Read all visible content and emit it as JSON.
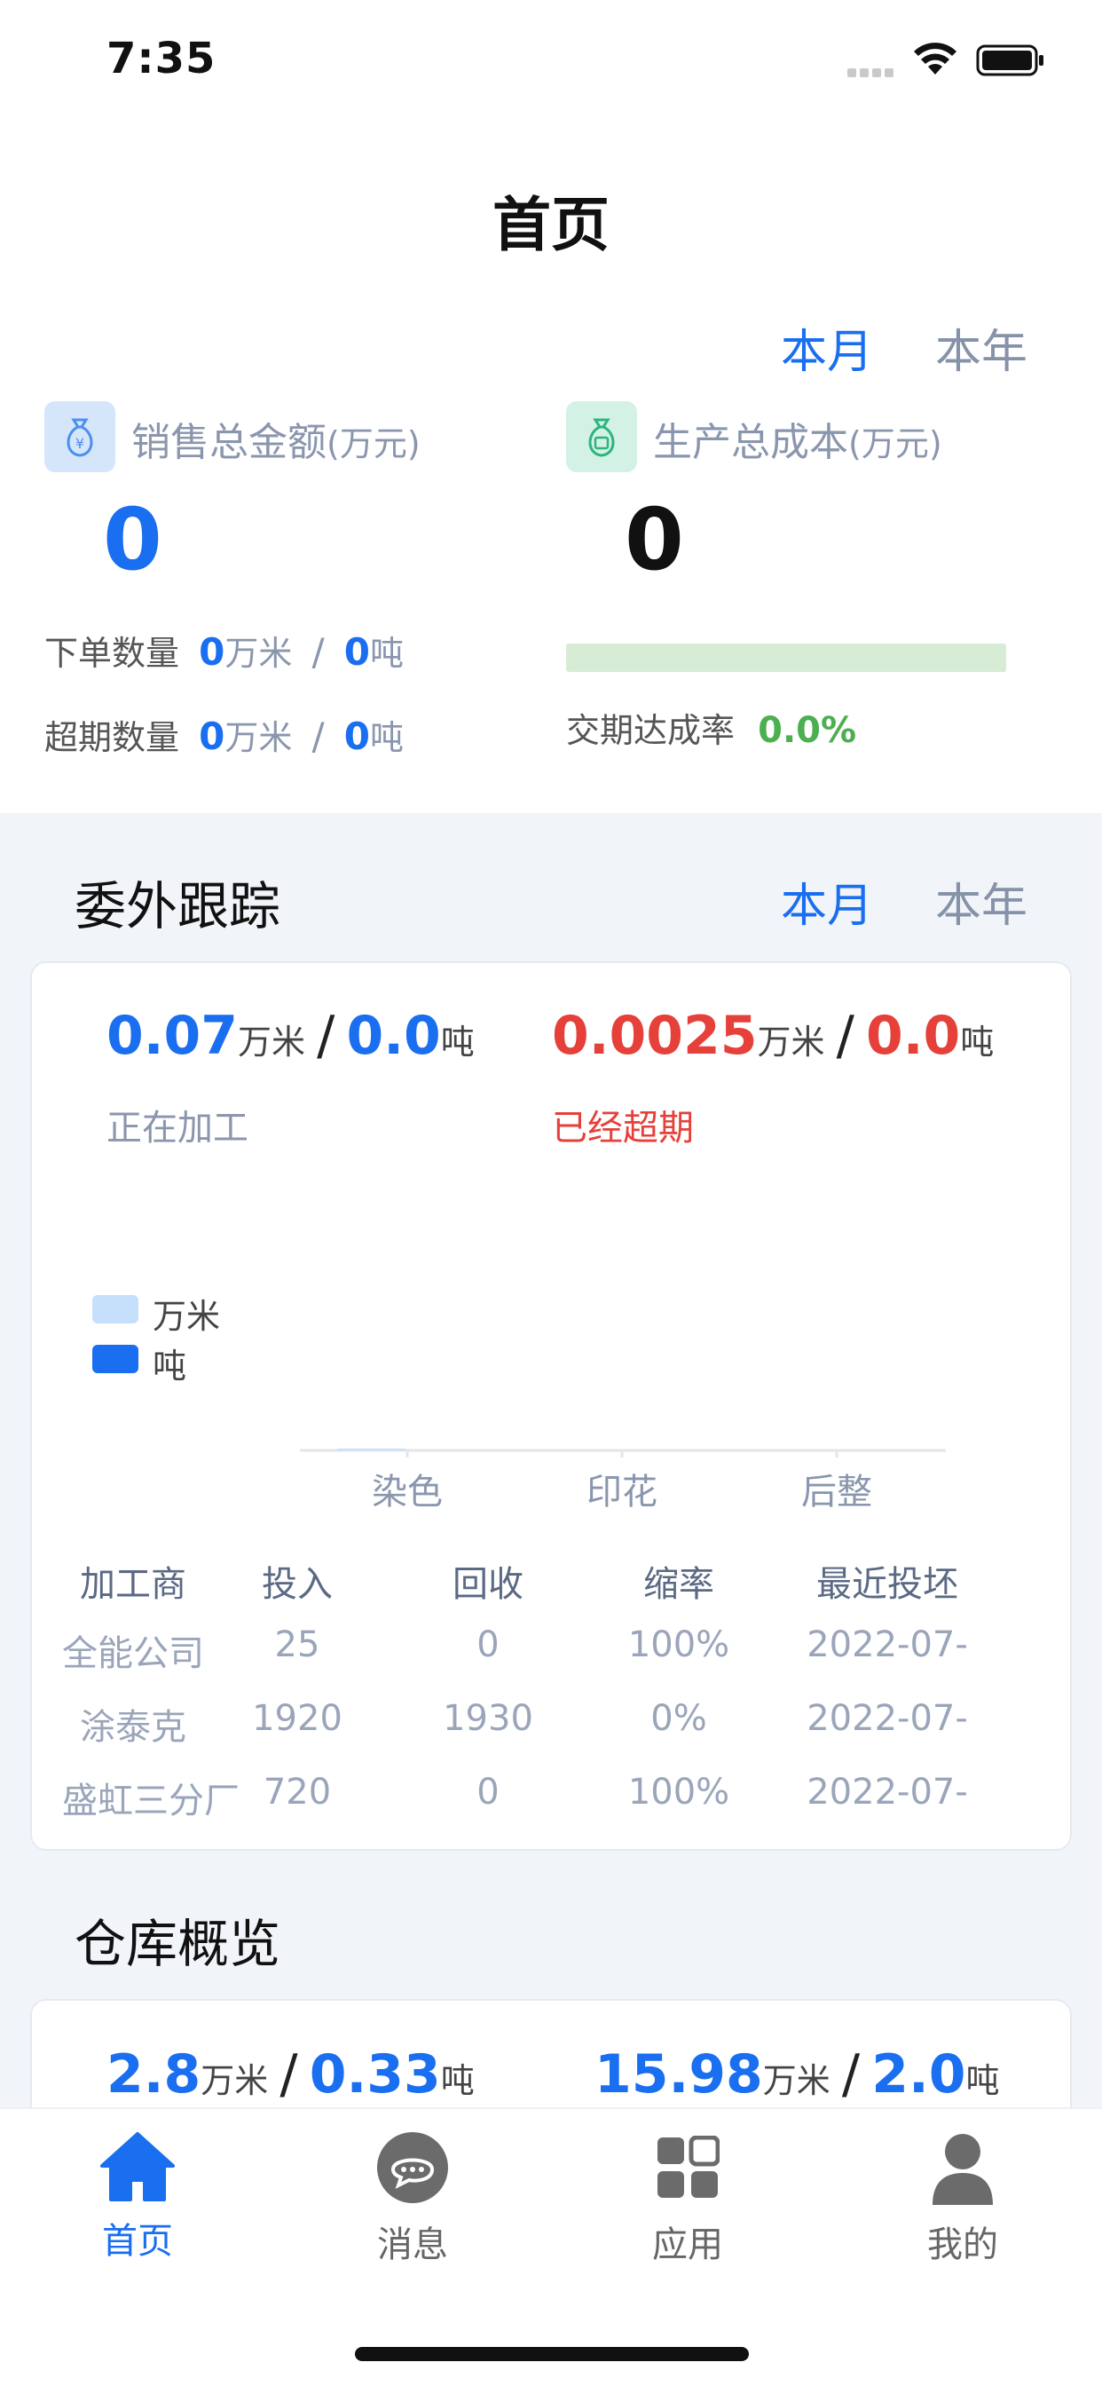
{
  "status": {
    "time": "7:35"
  },
  "header": {
    "title": "首页"
  },
  "top_tabs": {
    "month": "本月",
    "year": "本年"
  },
  "sales": {
    "label": "销售总金额",
    "unit": "(万元)",
    "value": "0",
    "order_label": "下单数量",
    "order_m": "0",
    "order_t": "0",
    "overdue_label": "超期数量",
    "overdue_m": "0",
    "overdue_t": "0",
    "unit_m": "万米",
    "unit_t": "吨",
    "slash": "/"
  },
  "cost": {
    "label": "生产总成本",
    "unit": "(万元)",
    "value": "0",
    "delivery_label": "交期达成率",
    "delivery_rate": "0.0%"
  },
  "outsource": {
    "title": "委外跟踪",
    "tabs": {
      "month": "本月",
      "year": "本年"
    },
    "processing_m": "0.07",
    "processing_t": "0.0",
    "processing_label": "正在加工",
    "overdue_m": "0.0025",
    "overdue_t": "0.0",
    "overdue_label": "已经超期",
    "unit_m": "万米",
    "unit_t": "吨",
    "slash": "/"
  },
  "chart_data": {
    "type": "bar",
    "categories": [
      "染色",
      "印花",
      "后整"
    ],
    "series": [
      {
        "name": "万米",
        "values": [
          0.07,
          0,
          0
        ]
      },
      {
        "name": "吨",
        "values": [
          0,
          0,
          0
        ]
      }
    ],
    "legend_placement": "top-left",
    "ylim": [
      0,
      2.0
    ],
    "grid": false
  },
  "table": {
    "headers": [
      "加工商",
      "投入",
      "回收",
      "缩率",
      "最近投坯"
    ],
    "rows": [
      [
        "全能公司",
        "25",
        "0",
        "100%",
        "2022-07-"
      ],
      [
        "涂泰克",
        "1920",
        "1930",
        "0%",
        "2022-07-"
      ],
      [
        "盛虹三分厂",
        "720",
        "0",
        "100%",
        "2022-07-"
      ]
    ]
  },
  "warehouse": {
    "title": "仓库概览",
    "a_m": "2.8",
    "a_t": "0.33",
    "b_m": "15.98",
    "b_t": "2.0",
    "unit_m": "万米",
    "unit_t": "吨",
    "slash": "/"
  },
  "nav": {
    "home": "首页",
    "messages": "消息",
    "apps": "应用",
    "mine": "我的"
  },
  "colors": {
    "accent": "#1a6ef0",
    "danger": "#e5413a",
    "success": "#4caf50",
    "legend_m": "#c6e0fb",
    "legend_t": "#1a6ef0"
  }
}
